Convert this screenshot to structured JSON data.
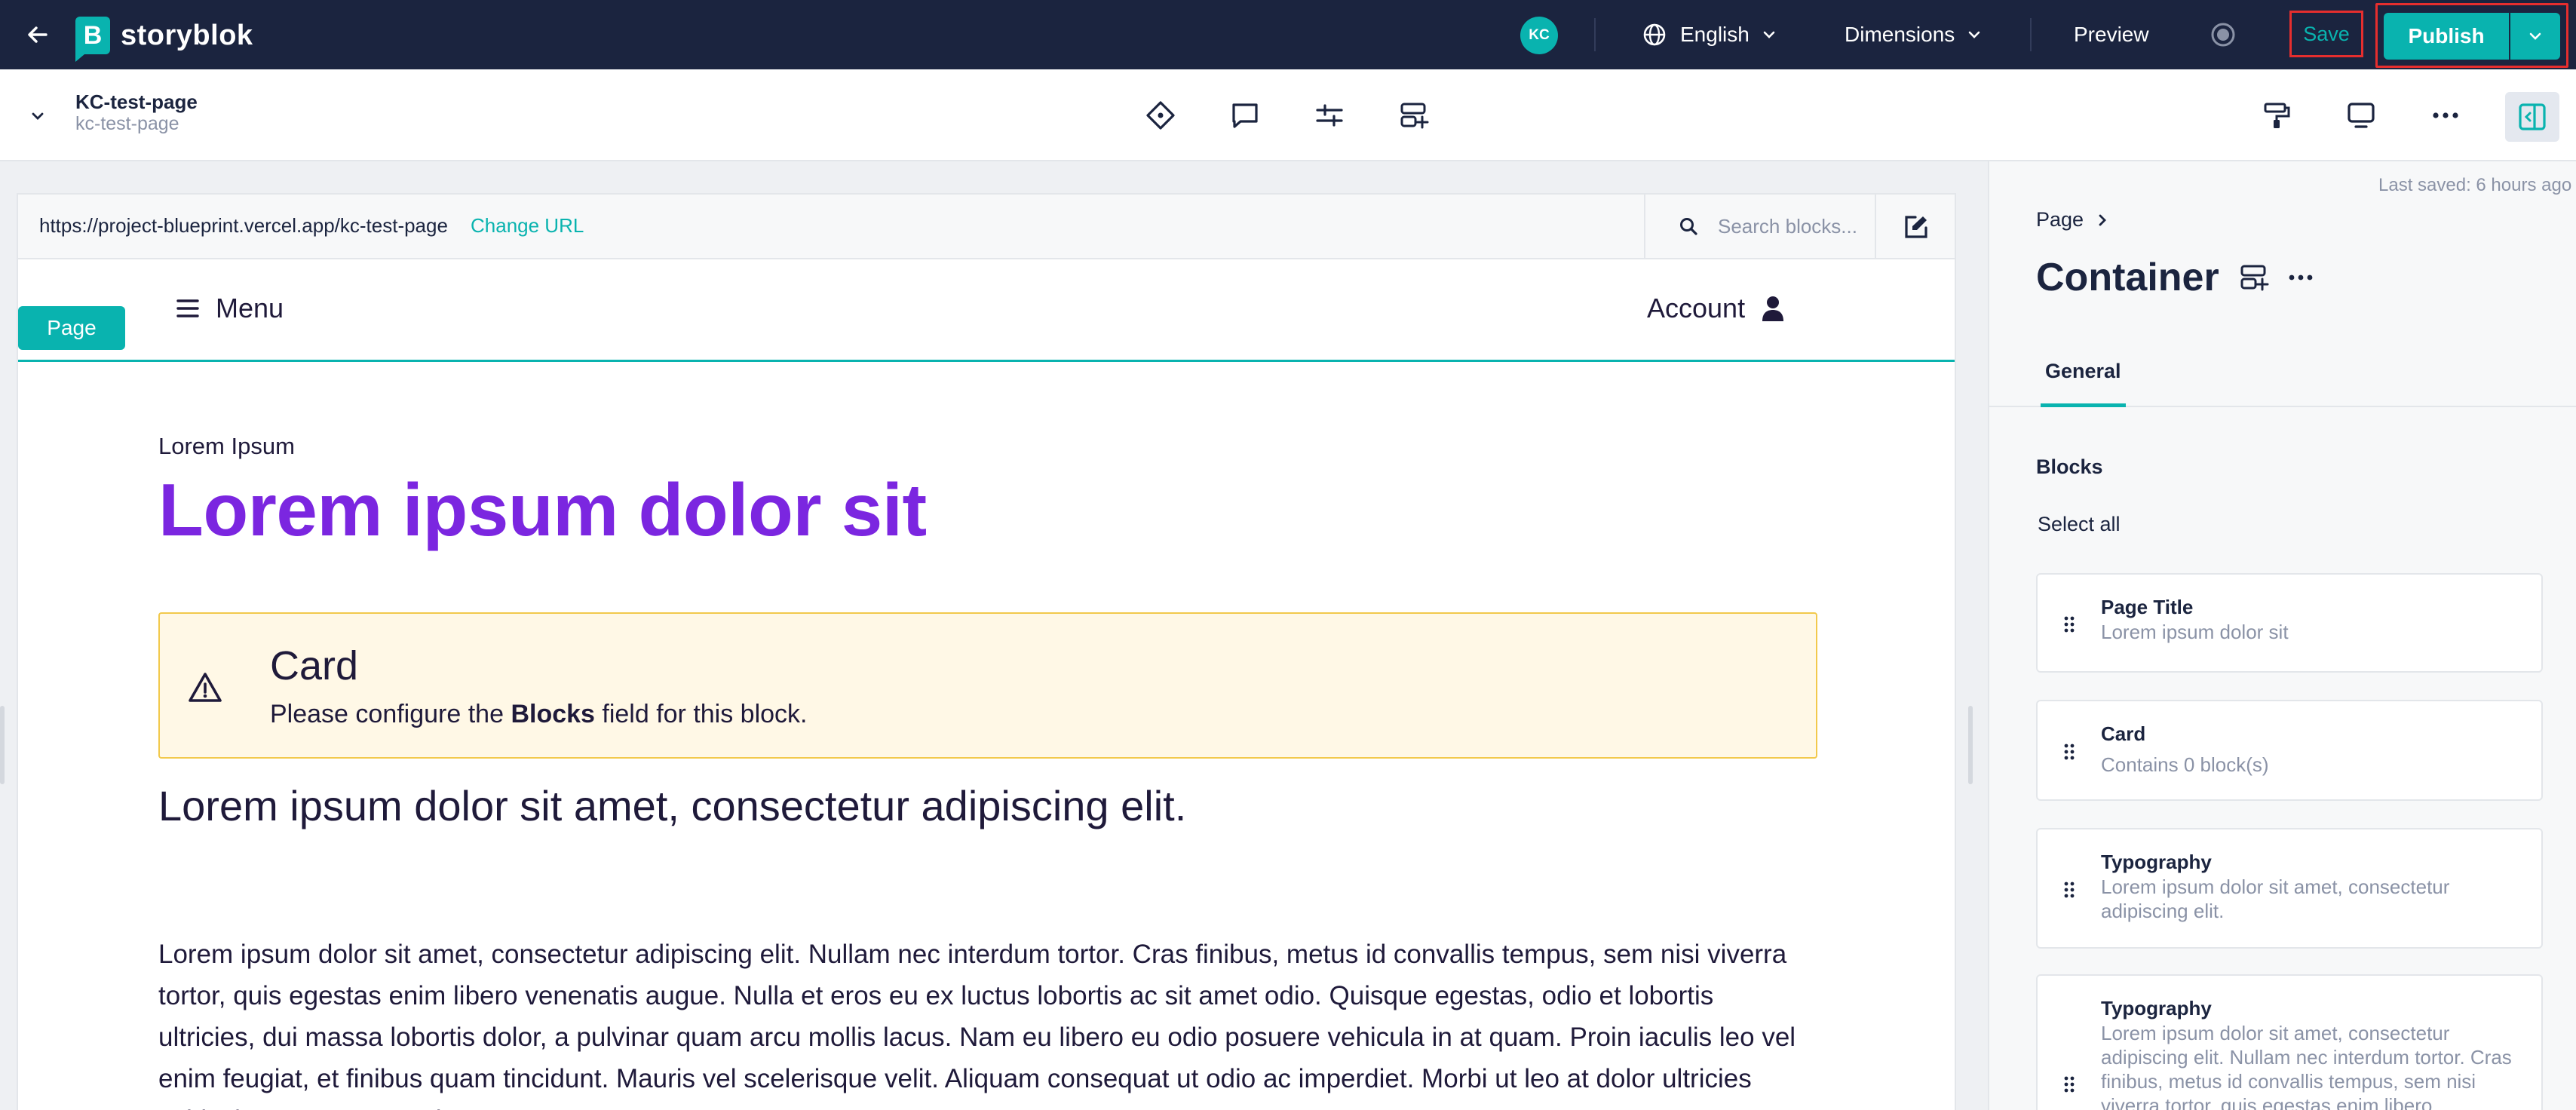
{
  "topbar": {
    "logo_text": "storyblok",
    "logo_letter": "B",
    "avatar_initials": "KC",
    "language": "English",
    "dimensions": "Dimensions",
    "preview": "Preview",
    "save": "Save",
    "publish": "Publish"
  },
  "story": {
    "name": "KC-test-page",
    "slug": "kc-test-page"
  },
  "canvas": {
    "url": "https://project-blueprint.vercel.app/kc-test-page",
    "change_url": "Change URL",
    "search_placeholder": "Search blocks...",
    "page_tag": "Page",
    "menu_label": "Menu",
    "account_label": "Account",
    "eyebrow": "Lorem Ipsum",
    "headline": "Lorem ipsum dolor sit",
    "warning": {
      "title": "Card",
      "msg_prefix": "Please configure the ",
      "msg_bold": "Blocks",
      "msg_suffix": " field for this block."
    },
    "subhead": "Lorem ipsum dolor sit amet, consectetur adipiscing elit.",
    "body": "Lorem ipsum dolor sit amet, consectetur adipiscing elit. Nullam nec interdum tortor. Cras finibus, metus id convallis tempus, sem nisi viverra tortor, quis egestas enim libero venenatis augue. Nulla et eros eu ex luctus lobortis ac sit amet odio. Quisque egestas, odio et lobortis ultricies, dui massa lobortis dolor, a pulvinar quam arcu mollis lacus. Nam eu libero eu odio posuere vehicula in at quam. Proin iaculis leo vel enim feugiat, et finibus quam tincidunt. Mauris vel scelerisque velit. Aliquam consequat ut odio ac imperdiet. Morbi ut leo at dolor ultricies vehicula consectetur at lorem."
  },
  "panel": {
    "last_saved": "Last saved: 6 hours ago",
    "breadcrumb": "Page",
    "title": "Container",
    "tab_general": "General",
    "field_label": "Blocks",
    "select_all": "Select all",
    "blocks": [
      {
        "name": "Page Title",
        "desc": "Lorem ipsum dolor sit"
      },
      {
        "name": "Card",
        "desc": "Contains 0 block(s)"
      },
      {
        "name": "Typography",
        "desc": "Lorem ipsum dolor sit amet, consectetur adipiscing elit."
      },
      {
        "name": "Typography",
        "desc": "Lorem ipsum dolor sit amet, consectetur adipiscing elit. Nullam nec interdum tortor. Cras finibus, metus id convallis tempus, sem nisi viverra tortor, quis egestas enim libero"
      }
    ]
  },
  "colors": {
    "navy": "#1b243f",
    "teal": "#09b3af",
    "purple": "#7b26e0",
    "highlight_red": "#e62e2e",
    "warning_bg": "#fff8e6",
    "warning_border": "#f2c94c"
  },
  "icons": {
    "back": "arrow-left-icon",
    "globe": "globe-icon",
    "chevron": "chevron-down-icon",
    "preview_status": "record-icon",
    "story_collapse": "chevron-down-icon",
    "toolbar": [
      "diamond-icon",
      "comment-icon",
      "sliders-icon",
      "add-block-icon"
    ],
    "right_tools": [
      "paint-roller-icon",
      "monitor-icon",
      "more-icon",
      "panel-toggle-icon"
    ],
    "search": "search-icon",
    "edit": "edit-icon",
    "menu": "hamburger-icon",
    "account": "user-icon",
    "warning": "warning-icon",
    "drag": "drag-handle-icon"
  }
}
